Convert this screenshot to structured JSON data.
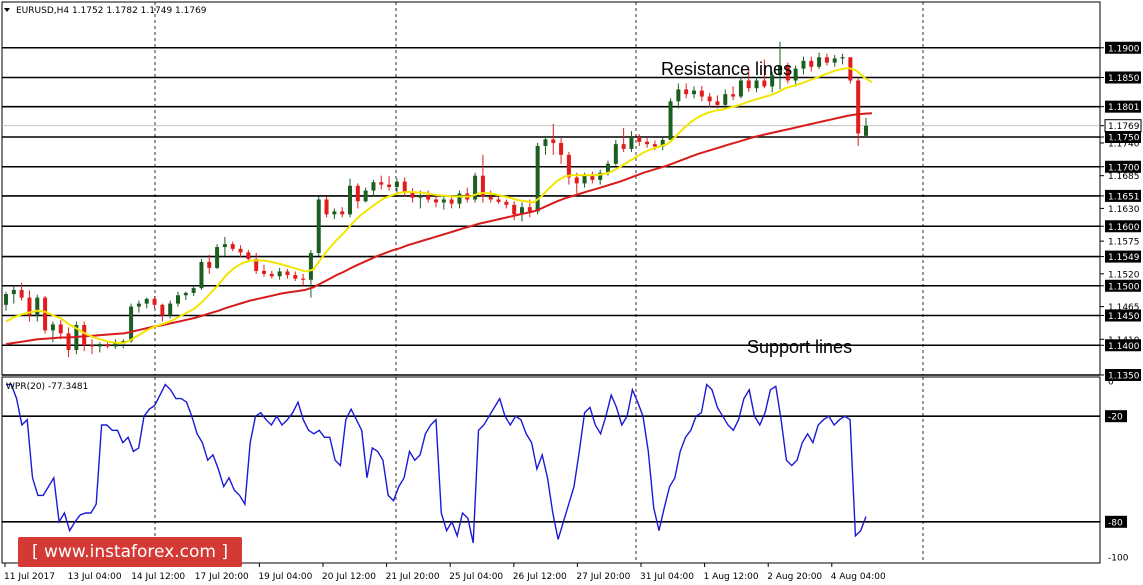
{
  "header": {
    "symbol_line": "EURUSD,H4  1.1752 1.1782 1.1749 1.1769"
  },
  "indicator": {
    "label": "WPR(20) -77.3481"
  },
  "annotations": {
    "resistance": "Resistance lines",
    "support": "Support lines"
  },
  "watermark": "[ www.instaforex.com ]",
  "colors": {
    "bull": "#1b5e20",
    "bear": "#e21b1b",
    "ma_fast": "#f2e600",
    "ma_slow": "#d81b1b",
    "wpr": "#1a1ad6",
    "price_tag_bg": "#000000",
    "brand": "#d33a35"
  },
  "chart_data": {
    "type": "candlestick",
    "price_axis": {
      "min": 1.135,
      "max": 1.195,
      "tick_labels": [
        "1.1900",
        "1.1850",
        "1.1801",
        "1.1769",
        "1.1750",
        "1.1740",
        "1.1700",
        "1.1685",
        "1.1651",
        "1.1630",
        "1.1600",
        "1.1575",
        "1.1549",
        "1.1520",
        "1.1500",
        "1.1465",
        "1.1450",
        "1.1410",
        "1.1400",
        "1.1350"
      ],
      "highlighted": [
        "1.1900",
        "1.1850",
        "1.1801",
        "1.1769",
        "1.1750",
        "1.1700",
        "1.1651",
        "1.1600",
        "1.1549",
        "1.1500",
        "1.1450",
        "1.1400",
        "1.1350"
      ]
    },
    "horizontal_levels": [
      1.19,
      1.185,
      1.1801,
      1.175,
      1.17,
      1.1651,
      1.16,
      1.1549,
      1.15,
      1.145,
      1.14,
      1.135
    ],
    "time_labels": [
      "11 Jul 2017",
      "13 Jul 04:00",
      "14 Jul 12:00",
      "17 Jul 20:00",
      "19 Jul 04:00",
      "20 Jul 12:00",
      "21 Jul 20:00",
      "25 Jul 04:00",
      "26 Jul 12:00",
      "27 Jul 20:00",
      "31 Jul 04:00",
      "1 Aug 12:00",
      "2 Aug 20:00",
      "4 Aug 04:00"
    ],
    "candles": [
      [
        1.1468,
        1.149,
        1.1458,
        1.1486
      ],
      [
        1.1486,
        1.15,
        1.147,
        1.1493
      ],
      [
        1.1493,
        1.1505,
        1.1475,
        1.148
      ],
      [
        1.148,
        1.1492,
        1.144,
        1.145
      ],
      [
        1.145,
        1.1485,
        1.144,
        1.148
      ],
      [
        1.148,
        1.1483,
        1.142,
        1.1425
      ],
      [
        1.1425,
        1.144,
        1.1405,
        1.1435
      ],
      [
        1.1435,
        1.1442,
        1.141,
        1.142
      ],
      [
        1.142,
        1.143,
        1.138,
        1.1392
      ],
      [
        1.1392,
        1.144,
        1.1385,
        1.1434
      ],
      [
        1.1434,
        1.144,
        1.139,
        1.14
      ],
      [
        1.14,
        1.141,
        1.1385,
        1.1398
      ],
      [
        1.1398,
        1.1405,
        1.1388,
        1.1402
      ],
      [
        1.1402,
        1.1408,
        1.1395,
        1.1398
      ],
      [
        1.1398,
        1.141,
        1.1394,
        1.1405
      ],
      [
        1.1405,
        1.141,
        1.1395,
        1.1407
      ],
      [
        1.1407,
        1.147,
        1.1404,
        1.1465
      ],
      [
        1.1465,
        1.1475,
        1.1455,
        1.147
      ],
      [
        1.147,
        1.148,
        1.1462,
        1.1478
      ],
      [
        1.1478,
        1.1482,
        1.1462,
        1.1468
      ],
      [
        1.1468,
        1.147,
        1.144,
        1.145
      ],
      [
        1.145,
        1.1475,
        1.1445,
        1.147
      ],
      [
        1.147,
        1.149,
        1.1465,
        1.1484
      ],
      [
        1.1484,
        1.149,
        1.1476,
        1.1488
      ],
      [
        1.1488,
        1.15,
        1.1483,
        1.1496
      ],
      [
        1.1496,
        1.1545,
        1.1493,
        1.154
      ],
      [
        1.154,
        1.1552,
        1.152,
        1.153
      ],
      [
        1.153,
        1.157,
        1.1528,
        1.1565
      ],
      [
        1.1565,
        1.1582,
        1.155,
        1.157
      ],
      [
        1.157,
        1.1574,
        1.1558,
        1.1562
      ],
      [
        1.1562,
        1.1568,
        1.1548,
        1.1556
      ],
      [
        1.1556,
        1.156,
        1.154,
        1.1545
      ],
      [
        1.1545,
        1.1555,
        1.152,
        1.1525
      ],
      [
        1.1525,
        1.1535,
        1.1515,
        1.152
      ],
      [
        1.152,
        1.1525,
        1.1512,
        1.1516
      ],
      [
        1.1516,
        1.153,
        1.151,
        1.1524
      ],
      [
        1.1524,
        1.1528,
        1.1512,
        1.1518
      ],
      [
        1.1518,
        1.1524,
        1.1508,
        1.1512
      ],
      [
        1.1512,
        1.152,
        1.15,
        1.151
      ],
      [
        1.151,
        1.156,
        1.148,
        1.1555
      ],
      [
        1.1555,
        1.165,
        1.155,
        1.1645
      ],
      [
        1.1645,
        1.165,
        1.1615,
        1.162
      ],
      [
        1.162,
        1.163,
        1.1612,
        1.1625
      ],
      [
        1.1625,
        1.1632,
        1.1615,
        1.162
      ],
      [
        1.162,
        1.168,
        1.1615,
        1.1668
      ],
      [
        1.1668,
        1.1672,
        1.163,
        1.1642
      ],
      [
        1.1642,
        1.1665,
        1.164,
        1.166
      ],
      [
        1.166,
        1.1678,
        1.165,
        1.1674
      ],
      [
        1.1674,
        1.1685,
        1.1662,
        1.167
      ],
      [
        1.167,
        1.1684,
        1.166,
        1.1666
      ],
      [
        1.1666,
        1.168,
        1.1655,
        1.1675
      ],
      [
        1.1675,
        1.1682,
        1.165,
        1.1658
      ],
      [
        1.1658,
        1.1664,
        1.164,
        1.1648
      ],
      [
        1.1648,
        1.166,
        1.163,
        1.1652
      ],
      [
        1.1652,
        1.166,
        1.164,
        1.1645
      ],
      [
        1.1645,
        1.1652,
        1.1632,
        1.164
      ],
      [
        1.164,
        1.165,
        1.1628,
        1.1645
      ],
      [
        1.1645,
        1.165,
        1.163,
        1.1638
      ],
      [
        1.1638,
        1.166,
        1.163,
        1.1655
      ],
      [
        1.1655,
        1.1665,
        1.164,
        1.1645
      ],
      [
        1.1645,
        1.169,
        1.164,
        1.1685
      ],
      [
        1.1685,
        1.172,
        1.164,
        1.165
      ],
      [
        1.165,
        1.166,
        1.164,
        1.1645
      ],
      [
        1.1645,
        1.165,
        1.1638,
        1.1641
      ],
      [
        1.1641,
        1.1645,
        1.163,
        1.1636
      ],
      [
        1.1636,
        1.1642,
        1.161,
        1.162
      ],
      [
        1.162,
        1.164,
        1.1608,
        1.1632
      ],
      [
        1.1632,
        1.1645,
        1.1615,
        1.1625
      ],
      [
        1.1625,
        1.174,
        1.162,
        1.1735
      ],
      [
        1.1735,
        1.1752,
        1.172,
        1.1746
      ],
      [
        1.1746,
        1.1772,
        1.172,
        1.174
      ],
      [
        1.174,
        1.1748,
        1.1705,
        1.172
      ],
      [
        1.172,
        1.1725,
        1.167,
        1.1682
      ],
      [
        1.1682,
        1.169,
        1.1655,
        1.1672
      ],
      [
        1.1672,
        1.169,
        1.1665,
        1.1685
      ],
      [
        1.1685,
        1.1692,
        1.1672,
        1.1678
      ],
      [
        1.1678,
        1.1695,
        1.167,
        1.169
      ],
      [
        1.169,
        1.171,
        1.1685,
        1.1705
      ],
      [
        1.1705,
        1.1745,
        1.1702,
        1.1738
      ],
      [
        1.1738,
        1.1765,
        1.1725,
        1.173
      ],
      [
        1.173,
        1.176,
        1.1725,
        1.175
      ],
      [
        1.175,
        1.1755,
        1.1735,
        1.1742
      ],
      [
        1.1742,
        1.1748,
        1.1732,
        1.1738
      ],
      [
        1.1738,
        1.1744,
        1.1728,
        1.1734
      ],
      [
        1.1734,
        1.175,
        1.1728,
        1.1745
      ],
      [
        1.1745,
        1.1815,
        1.1742,
        1.181
      ],
      [
        1.181,
        1.184,
        1.1798,
        1.183
      ],
      [
        1.183,
        1.184,
        1.1815,
        1.1822
      ],
      [
        1.1822,
        1.1835,
        1.1815,
        1.1828
      ],
      [
        1.1828,
        1.1836,
        1.181,
        1.1818
      ],
      [
        1.1818,
        1.1824,
        1.18,
        1.181
      ],
      [
        1.181,
        1.182,
        1.1798,
        1.1804
      ],
      [
        1.1804,
        1.183,
        1.18,
        1.1822
      ],
      [
        1.1822,
        1.1835,
        1.1812,
        1.1818
      ],
      [
        1.1818,
        1.185,
        1.1815,
        1.1845
      ],
      [
        1.1845,
        1.1865,
        1.1826,
        1.1832
      ],
      [
        1.1832,
        1.185,
        1.1825,
        1.1845
      ],
      [
        1.1845,
        1.188,
        1.1832,
        1.1835
      ],
      [
        1.1835,
        1.186,
        1.1825,
        1.1854
      ],
      [
        1.1854,
        1.191,
        1.183,
        1.187
      ],
      [
        1.187,
        1.1875,
        1.184,
        1.1845
      ],
      [
        1.1845,
        1.187,
        1.1835,
        1.1865
      ],
      [
        1.1865,
        1.1885,
        1.1855,
        1.1878
      ],
      [
        1.1878,
        1.1885,
        1.186,
        1.1868
      ],
      [
        1.1868,
        1.1892,
        1.1864,
        1.1884
      ],
      [
        1.1884,
        1.189,
        1.187,
        1.1875
      ],
      [
        1.1875,
        1.1888,
        1.1868,
        1.1882
      ],
      [
        1.1882,
        1.189,
        1.1872,
        1.1884
      ],
      [
        1.1884,
        1.1884,
        1.184,
        1.1845
      ],
      [
        1.1845,
        1.185,
        1.1735,
        1.1756
      ],
      [
        1.1752,
        1.1782,
        1.1749,
        1.1769
      ]
    ],
    "ma_fast": [
      1.144,
      1.1447,
      1.1452,
      1.1455,
      1.1458,
      1.1456,
      1.145,
      1.1445,
      1.1435,
      1.1428,
      1.142,
      1.1414,
      1.141,
      1.1406,
      1.1404,
      1.1404,
      1.141,
      1.1418,
      1.1426,
      1.1432,
      1.1436,
      1.1441,
      1.1448,
      1.1455,
      1.1462,
      1.1474,
      1.1488,
      1.1502,
      1.1518,
      1.153,
      1.1538,
      1.1542,
      1.1543,
      1.1542,
      1.1539,
      1.1536,
      1.1532,
      1.1528,
      1.1524,
      1.1527,
      1.1545,
      1.1562,
      1.1577,
      1.159,
      1.1605,
      1.1618,
      1.1628,
      1.1638,
      1.1647,
      1.1652,
      1.1656,
      1.1658,
      1.1657,
      1.1656,
      1.1654,
      1.1652,
      1.1651,
      1.165,
      1.165,
      1.165,
      1.1655,
      1.1656,
      1.1654,
      1.1651,
      1.1648,
      1.1644,
      1.1642,
      1.164,
      1.165,
      1.1664,
      1.1676,
      1.1684,
      1.1686,
      1.1686,
      1.1686,
      1.1686,
      1.1688,
      1.1692,
      1.17,
      1.1708,
      1.1716,
      1.1724,
      1.173,
      1.1734,
      1.1738,
      1.175,
      1.1764,
      1.1775,
      1.1784,
      1.179,
      1.1794,
      1.1796,
      1.18,
      1.1803,
      1.1808,
      1.1812,
      1.1816,
      1.182,
      1.1825,
      1.1832,
      1.1836,
      1.184,
      1.1845,
      1.185,
      1.1855,
      1.186,
      1.1864,
      1.1866,
      1.1862,
      1.185,
      1.1842
    ],
    "ma_slow": [
      1.1402,
      1.1404,
      1.1406,
      1.1408,
      1.141,
      1.1411,
      1.1412,
      1.1413,
      1.1413,
      1.1414,
      1.1415,
      1.1416,
      1.1417,
      1.1418,
      1.1419,
      1.142,
      1.1423,
      1.1426,
      1.1429,
      1.1432,
      1.1434,
      1.1437,
      1.144,
      1.1443,
      1.1446,
      1.145,
      1.1454,
      1.1458,
      1.1463,
      1.1467,
      1.1471,
      1.1475,
      1.1478,
      1.1481,
      1.1484,
      1.1487,
      1.1489,
      1.1491,
      1.1493,
      1.1497,
      1.1504,
      1.1511,
      1.1518,
      1.1524,
      1.1531,
      1.1537,
      1.1543,
      1.1549,
      1.1554,
      1.1559,
      1.1563,
      1.1568,
      1.1572,
      1.1576,
      1.158,
      1.1584,
      1.1588,
      1.1592,
      1.1596,
      1.16,
      1.1604,
      1.1607,
      1.161,
      1.1613,
      1.1616,
      1.1619,
      1.1622,
      1.1625,
      1.163,
      1.1636,
      1.1642,
      1.1647,
      1.1651,
      1.1655,
      1.1659,
      1.1663,
      1.1667,
      1.1671,
      1.1675,
      1.168,
      1.1685,
      1.169,
      1.1694,
      1.1698,
      1.1702,
      1.1707,
      1.1712,
      1.1717,
      1.1722,
      1.1726,
      1.173,
      1.1734,
      1.1738,
      1.1742,
      1.1746,
      1.175,
      1.1753,
      1.1756,
      1.1759,
      1.1762,
      1.1765,
      1.1768,
      1.1771,
      1.1774,
      1.1777,
      1.178,
      1.1783,
      1.1786,
      1.1788,
      1.1789,
      1.179
    ],
    "wpr": {
      "name": "WPR(20)",
      "last": -77.3481,
      "levels": [
        -20,
        -80
      ],
      "range": [
        -100,
        0
      ],
      "tick_labels": [
        "0",
        "-20",
        "-80",
        "-100"
      ],
      "values": [
        -2,
        -2,
        -10,
        -25,
        -22,
        -55,
        -65,
        -65,
        -60,
        -55,
        -80,
        -75,
        -85,
        -80,
        -76,
        -75,
        -75,
        -70,
        -25,
        -25,
        -28,
        -28,
        -35,
        -32,
        -40,
        -38,
        -20,
        -16,
        -14,
        -8,
        -2,
        -5,
        -10,
        -10,
        -12,
        -20,
        -30,
        -35,
        -45,
        -42,
        -50,
        -60,
        -55,
        -62,
        -65,
        -70,
        -35,
        -20,
        -18,
        -22,
        -25,
        -20,
        -25,
        -22,
        -18,
        -12,
        -22,
        -28,
        -30,
        -28,
        -32,
        -32,
        -45,
        -48,
        -22,
        -16,
        -22,
        -28,
        -55,
        -38,
        -40,
        -45,
        -65,
        -68,
        -60,
        -55,
        -40,
        -45,
        -42,
        -30,
        -25,
        -22,
        -75,
        -85,
        -80,
        -88,
        -75,
        -78,
        -92,
        -28,
        -25,
        -20,
        -15,
        -10,
        -20,
        -25,
        -20,
        -22,
        -30,
        -35,
        -50,
        -42,
        -55,
        -75,
        -90,
        -80,
        -70,
        -60,
        -40,
        -18,
        -15,
        -25,
        -30,
        -20,
        -8,
        -15,
        -25,
        -20,
        -5,
        -12,
        -20,
        -40,
        -72,
        -85,
        -72,
        -60,
        -55,
        -40,
        -32,
        -28,
        -20,
        -18,
        -2,
        -5,
        -15,
        -20,
        -25,
        -28,
        -22,
        -10,
        -5,
        -20,
        -25,
        -18,
        -5,
        -3,
        -22,
        -45,
        -48,
        -45,
        -35,
        -30,
        -35,
        -25,
        -22,
        -20,
        -25,
        -22,
        -20,
        -22,
        -88,
        -85,
        -77
      ]
    }
  }
}
